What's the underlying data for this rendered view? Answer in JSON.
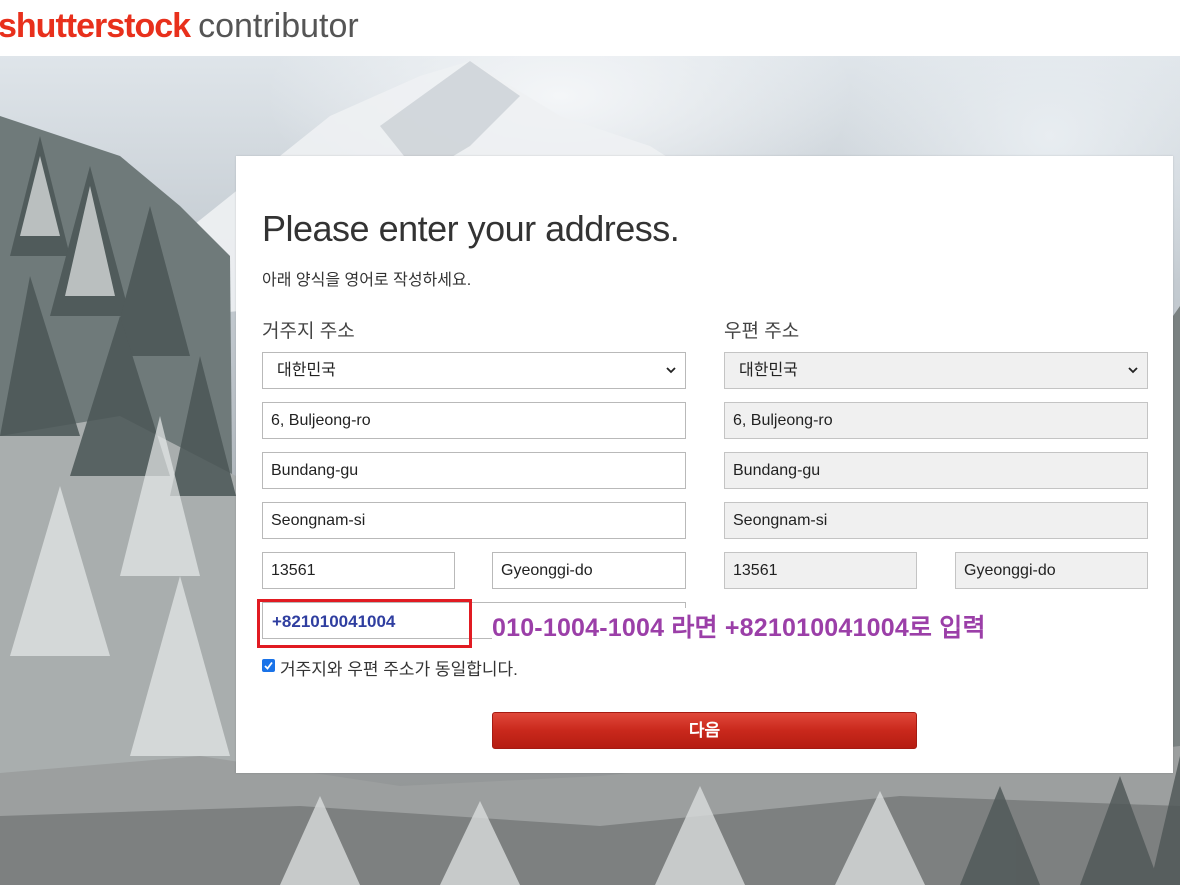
{
  "header": {
    "brand": "shutterstock",
    "product": "contributor"
  },
  "form": {
    "title": "Please enter your address.",
    "subtitle": "아래 양식을 영어로 작성하세요.",
    "residence": {
      "label": "거주지 주소",
      "country": "대한민국",
      "address1": "6, Buljeong-ro",
      "address2": "Bundang-gu",
      "city": "Seongnam-si",
      "postal_code": "13561",
      "state": "Gyeonggi-do"
    },
    "mailing": {
      "label": "우편 주소",
      "country": "대한민국",
      "address1": "6, Buljeong-ro",
      "address2": "Bundang-gu",
      "city": "Seongnam-si",
      "postal_code": "13561",
      "state": "Gyeonggi-do"
    },
    "phone": "+821010041004",
    "annotation": "010-1004-1004 라면   +821010041004로 입력",
    "same_address_checkbox": {
      "label": "거주지와 우편 주소가 동일합니다.",
      "checked": true
    },
    "next_button": "다음"
  },
  "colors": {
    "brand_red": "#e8301c",
    "annotation_purple": "#9b3fa8",
    "highlight_red": "#e11b22",
    "phone_blue": "#2f3ea0",
    "button_red": "#c9281c"
  }
}
